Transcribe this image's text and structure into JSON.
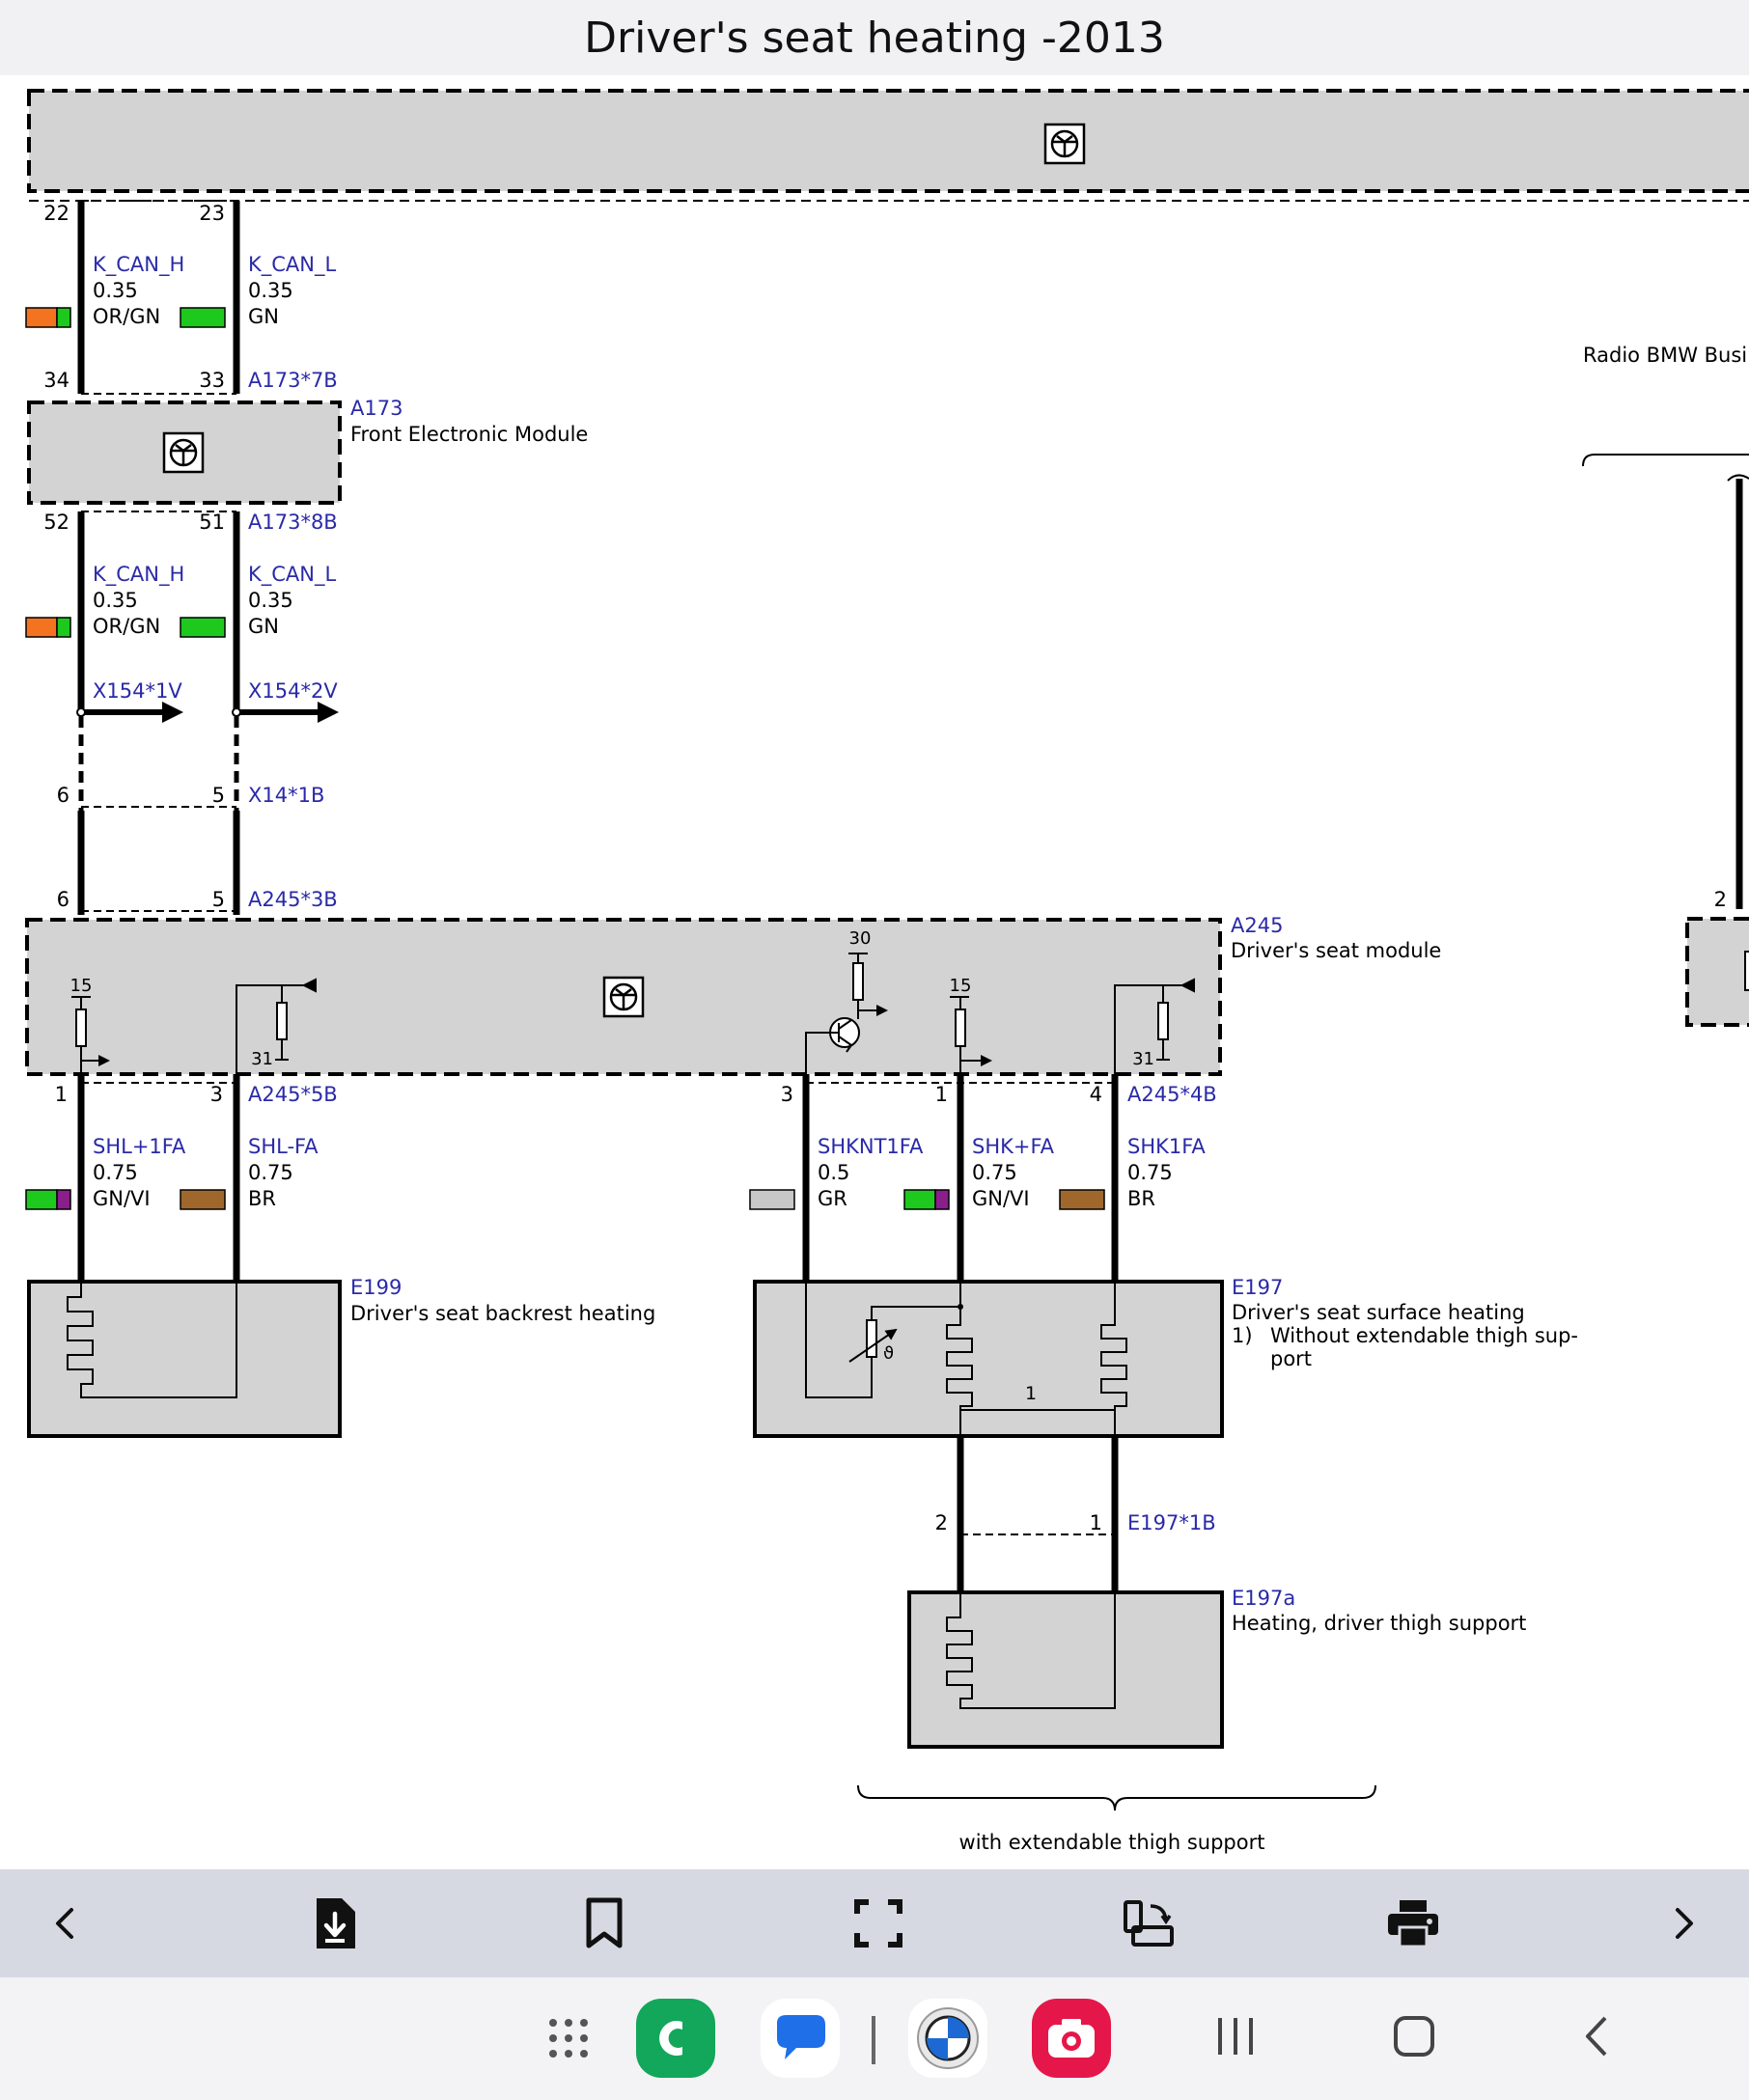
{
  "page": {
    "title": "Driver's seat heating -2013"
  },
  "colors": {
    "accent_blue": "#2a2aa8",
    "module_fill": "#d3d3d3",
    "wire_orange": "#f47320",
    "wire_green": "#1ec91e",
    "wire_violet": "#8a1e8a",
    "wire_brown": "#a0672d",
    "wire_gray": "#c8c8c8",
    "toolbar_bg": "#d7d9e2",
    "navbar_bg": "#f3f3f5"
  },
  "diagram": {
    "top_module": {
      "pins": {
        "left": "22",
        "right": "23"
      }
    },
    "can_wires": {
      "high": {
        "signal": "K_CAN_H",
        "gauge": "0.35",
        "color": "OR/GN"
      },
      "low": {
        "signal": "K_CAN_L",
        "gauge": "0.35",
        "color": "GN"
      }
    },
    "a173": {
      "id": "A173",
      "name": "Front Electronic Module",
      "conn_top": "A173*7B",
      "pins_top": {
        "left": "34",
        "right": "33"
      },
      "conn_bottom": "A173*8B",
      "pins_bottom": {
        "left": "52",
        "right": "51"
      }
    },
    "x154": {
      "left": "X154*1V",
      "right": "X154*2V"
    },
    "x14": {
      "id": "X14*1B",
      "pins": {
        "left": "6",
        "right": "5"
      }
    },
    "a245": {
      "id": "A245",
      "name": "Driver's seat module",
      "conn3": "A245*3B",
      "conn3_pins": {
        "left": "6",
        "right": "5"
      },
      "conn5": "A245*5B",
      "conn4": "A245*4B",
      "internal": {
        "t15": "15",
        "t31": "31",
        "t30": "30"
      },
      "pins5": [
        "1",
        "3"
      ],
      "pins4": [
        "3",
        "1",
        "4"
      ]
    },
    "heater_wires": [
      {
        "signal": "SHL+1FA",
        "gauge": "0.75",
        "color": "GN/VI"
      },
      {
        "signal": "SHL-FA",
        "gauge": "0.75",
        "color": "BR"
      },
      {
        "signal": "SHKNT1FA",
        "gauge": "0.5",
        "color": "GR"
      },
      {
        "signal": "SHK+FA",
        "gauge": "0.75",
        "color": "GN/VI"
      },
      {
        "signal": "SHK1FA",
        "gauge": "0.75",
        "color": "BR"
      }
    ],
    "e199": {
      "id": "E199",
      "name": "Driver's seat backrest heating"
    },
    "e197": {
      "id": "E197",
      "name": "Driver's seat surface heating",
      "note_num": "1)",
      "note_line1": "Without extendable thigh sup-",
      "note_line2": "port",
      "bridge_label": "1",
      "theta": "ϑ"
    },
    "e197_1b": {
      "id": "E197*1B",
      "pins": {
        "left": "2",
        "right": "1"
      }
    },
    "e197a": {
      "id": "E197a",
      "name": "Heating, driver thigh support"
    },
    "brace_label": "with extendable thigh support",
    "radio": {
      "name": "Radio BMW Busi",
      "pin": "2"
    }
  },
  "toolbar": {
    "prev": "chevron-left-icon",
    "download": "download-icon",
    "bookmark": "bookmark-icon",
    "fullscreen": "fullscreen-icon",
    "rotate": "rotate-screen-icon",
    "print": "print-icon",
    "next": "chevron-right-icon"
  },
  "navbar": {
    "apps": [
      "app-drawer-icon",
      "phone-app-icon",
      "messages-app-icon",
      "bmw-app-icon",
      "camera-app-icon"
    ],
    "buttons": [
      "recents-icon",
      "home-icon",
      "back-icon"
    ]
  }
}
